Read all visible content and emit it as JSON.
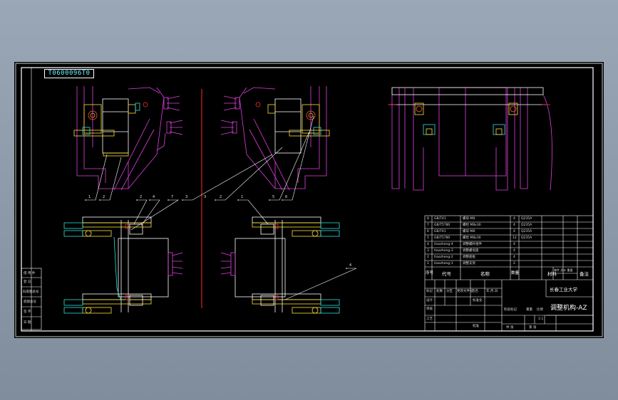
{
  "drawing": {
    "code": "T0600096T0",
    "title_block": {
      "university": "长春工业大学",
      "drawing_name": "调整机构-AZ",
      "scale_label": "比例",
      "stage_label": "阶段标记",
      "weight_label": "重量",
      "scale_value": "1:1",
      "sheet_label": "共 张",
      "sheet_of_label": "第 张"
    },
    "bom_headers": [
      "序号",
      "代号",
      "名称",
      "数量",
      "材料",
      "单件 总计 重量",
      "备注"
    ],
    "bom_rows": [
      [
        "8",
        "GB/T41",
        "螺母 M8",
        "4",
        "Q235A",
        ""
      ],
      [
        "7",
        "GB/T5780",
        "螺栓 M8x30",
        "4",
        "Q235A",
        ""
      ],
      [
        "6",
        "GB/T41",
        "螺母 M8",
        "4",
        "Q235A",
        ""
      ],
      [
        "5",
        "GB/T5780",
        "螺栓 M8x30",
        "12",
        "Q235A",
        ""
      ],
      [
        "4",
        "tiaozheng-4",
        "调整螺杆组件",
        "4",
        "",
        ""
      ],
      [
        "3",
        "tiaozheng-3",
        "调整螺母座",
        "4",
        "",
        ""
      ],
      [
        "2",
        "tiaozheng-2",
        "调整座板",
        "4",
        "",
        ""
      ],
      [
        "1",
        "tiaozheng-1",
        "调整支架",
        "2",
        "",
        ""
      ]
    ],
    "revision_labels": [
      "标记",
      "处数",
      "分区",
      "更改文件号",
      "签名",
      "年.月.日"
    ],
    "role_labels": [
      "设计",
      "标准化",
      "审核",
      "工艺",
      "批准"
    ],
    "left_strip_labels": [
      "借 用 件",
      "登 记",
      "旧底图总号",
      "底图总号",
      "签 字",
      "日 期"
    ],
    "balloons": [
      "1",
      "2",
      "2",
      "4",
      "7",
      "3",
      "3",
      "2",
      "1",
      "5",
      "6",
      "4"
    ]
  }
}
